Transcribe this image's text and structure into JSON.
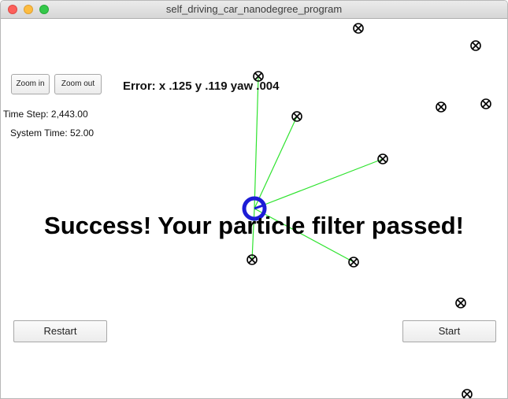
{
  "window": {
    "title": "self_driving_car_nanodegree_program"
  },
  "controls": {
    "zoom_in_label": "Zoom in",
    "zoom_out_label": "Zoom out",
    "restart_label": "Restart",
    "start_label": "Start"
  },
  "stats": {
    "time_step": "Time Step: 2,443.00",
    "system_time": "System Time: 52.00",
    "error": "Error: x .125 y .119 yaw .004"
  },
  "message": "Success! Your particle filter passed!",
  "colors": {
    "observation_line": "#2ee32e",
    "vehicle": "#1c1cd6",
    "landmark": "#000000"
  }
}
